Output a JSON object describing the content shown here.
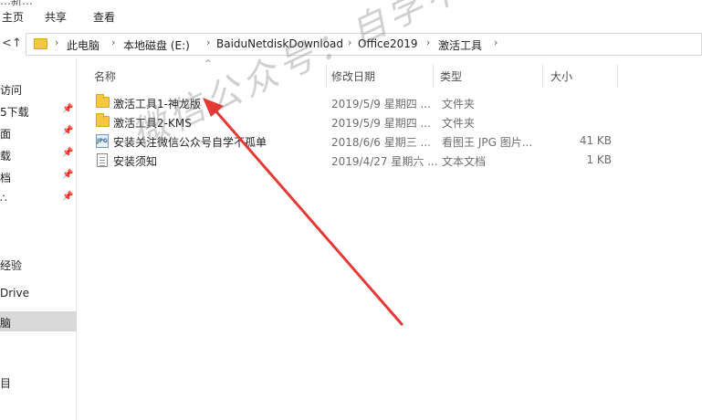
{
  "ribbon": {
    "cut_title": "…新…",
    "tabs": [
      "主页",
      "共享",
      "查看"
    ]
  },
  "address": {
    "back_icon": "back-arrow-icon",
    "up_icon": "up-arrow-icon",
    "crumbs": [
      "此电脑",
      "本地磁盘 (E:)",
      "BaiduNetdiskDownload",
      "Office2019",
      "激活工具"
    ]
  },
  "nav": {
    "items": [
      {
        "label": "访问",
        "pinned": false
      },
      {
        "label": "5下载",
        "pinned": true
      },
      {
        "label": "面",
        "pinned": true
      },
      {
        "label": "载",
        "pinned": true
      },
      {
        "label": "档",
        "pinned": true
      },
      {
        "label": "∴",
        "pinned": true
      },
      {
        "label": "经验",
        "pinned": false
      },
      {
        "label": "Drive",
        "pinned": false
      },
      {
        "label": "脑",
        "pinned": false
      },
      {
        "label": "目",
        "pinned": false
      }
    ],
    "pin_glyph": "📌"
  },
  "columns": {
    "name": "名称",
    "date": "修改日期",
    "type": "类型",
    "size": "大小"
  },
  "files": [
    {
      "name": "激活工具1-神龙版",
      "date": "2019/5/9 星期四 ...",
      "type": "文件夹",
      "size": "",
      "icon": "folder-icon"
    },
    {
      "name": "激活工具2-KMS",
      "date": "2019/5/9 星期四 ...",
      "type": "文件夹",
      "size": "",
      "icon": "folder-icon"
    },
    {
      "name": "安装关注微信公众号自学不孤单",
      "date": "2018/6/6 星期三 ...",
      "type": "看图王 JPG 图片...",
      "size": "41 KB",
      "icon": "jpg-icon"
    },
    {
      "name": "安装须知",
      "date": "2019/4/27 星期六 ...",
      "type": "文本文档",
      "size": "1 KB",
      "icon": "text-file-icon"
    }
  ],
  "jpg_icon_label": "JPG",
  "watermark": "微信公众号：自学不孤单",
  "colors": {
    "arrow": "#e53935",
    "folder": "#f4c842",
    "selected_nav": "#d9d9d9"
  }
}
